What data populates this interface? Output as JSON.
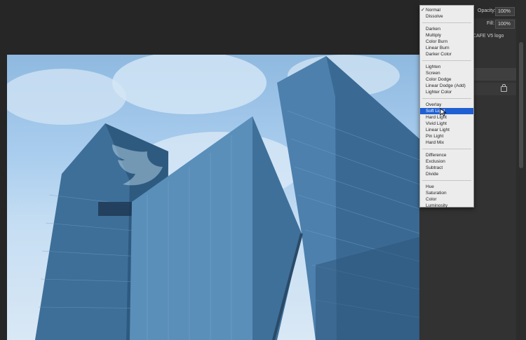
{
  "panel": {
    "opacity_label": "Opacity:",
    "opacity_value": "100%",
    "fill_label": "Fill:",
    "fill_value": "100%",
    "layer_name": "CAFE V5 logo"
  },
  "blend_menu": {
    "selected": "Soft Light",
    "checked": "Normal",
    "groups": [
      [
        "Normal",
        "Dissolve"
      ],
      [
        "Darken",
        "Multiply",
        "Color Burn",
        "Linear Burn",
        "Darker Color"
      ],
      [
        "Lighten",
        "Screen",
        "Color Dodge",
        "Linear Dodge (Add)",
        "Lighter Color"
      ],
      [
        "Overlay",
        "Soft Light",
        "Hard Light",
        "Vivid Light",
        "Linear Light",
        "Pin Light",
        "Hard Mix"
      ],
      [
        "Difference",
        "Exclusion",
        "Subtract",
        "Divide"
      ],
      [
        "Hue",
        "Saturation",
        "Color",
        "Luminosity"
      ]
    ]
  },
  "colors": {
    "selection": "#1f5fd1",
    "workspace": "#262626",
    "panel": "#323232"
  },
  "icons": {
    "canvas_logo": "twitter-bird-icon",
    "layer_lock": "lock-icon",
    "pointer": "cursor-arrow-icon"
  }
}
